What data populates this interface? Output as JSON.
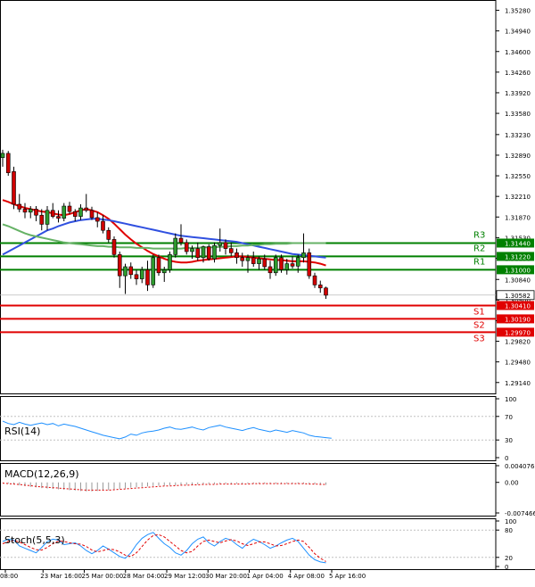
{
  "chart_data": {
    "type": "candlestick",
    "symbol": "GBPUSD",
    "price_axis": {
      "ylim": [
        1.2896,
        1.3545
      ],
      "ticks": [
        "1.35280",
        "1.34940",
        "1.34600",
        "1.34260",
        "1.33920",
        "1.33580",
        "1.33230",
        "1.32890",
        "1.32550",
        "1.32210",
        "1.31870",
        "1.31530",
        "1.31190",
        "1.30840",
        "1.30500",
        "1.30160",
        "1.29820",
        "1.29480",
        "1.29140"
      ]
    },
    "current_price": {
      "label": "1.30582",
      "value": 1.30582
    },
    "levels": [
      {
        "name": "R3",
        "label": "1.31440",
        "value": 1.3144,
        "color": "#008000"
      },
      {
        "name": "R2",
        "label": "1.31220",
        "value": 1.3122,
        "color": "#008000"
      },
      {
        "name": "R1",
        "label": "1.31000",
        "value": 1.31,
        "color": "#008000"
      },
      {
        "name": "S1",
        "label": "1.30410",
        "value": 1.3041,
        "color": "#e00000"
      },
      {
        "name": "S2",
        "label": "1.30190",
        "value": 1.3019,
        "color": "#e00000"
      },
      {
        "name": "S3",
        "label": "1.29970",
        "value": 1.2997,
        "color": "#e00000"
      }
    ],
    "time_labels": [
      "08:00",
      "23 Mar 16:00",
      "25 Mar 00:00",
      "28 Mar 04:00",
      "29 Mar 12:00",
      "30 Mar 20:00",
      "1 Apr 04:00",
      "4 Apr 08:00",
      "5 Apr 16:00"
    ],
    "candles": [
      {
        "o": 1.3285,
        "h": 1.3298,
        "l": 1.327,
        "c": 1.3292
      },
      {
        "o": 1.3292,
        "h": 1.3296,
        "l": 1.3255,
        "c": 1.326
      },
      {
        "o": 1.3262,
        "h": 1.327,
        "l": 1.32,
        "c": 1.3208
      },
      {
        "o": 1.3208,
        "h": 1.3225,
        "l": 1.3195,
        "c": 1.32
      },
      {
        "o": 1.32,
        "h": 1.321,
        "l": 1.3185,
        "c": 1.3195
      },
      {
        "o": 1.3195,
        "h": 1.3205,
        "l": 1.3185,
        "c": 1.32
      },
      {
        "o": 1.32,
        "h": 1.3205,
        "l": 1.318,
        "c": 1.319
      },
      {
        "o": 1.319,
        "h": 1.32,
        "l": 1.3165,
        "c": 1.3175
      },
      {
        "o": 1.3175,
        "h": 1.3205,
        "l": 1.3165,
        "c": 1.3198
      },
      {
        "o": 1.3198,
        "h": 1.321,
        "l": 1.3185,
        "c": 1.3188
      },
      {
        "o": 1.3188,
        "h": 1.3198,
        "l": 1.3178,
        "c": 1.3185
      },
      {
        "o": 1.3185,
        "h": 1.321,
        "l": 1.318,
        "c": 1.3205
      },
      {
        "o": 1.3205,
        "h": 1.3212,
        "l": 1.3192,
        "c": 1.3196
      },
      {
        "o": 1.3196,
        "h": 1.32,
        "l": 1.318,
        "c": 1.3188
      },
      {
        "o": 1.3188,
        "h": 1.3208,
        "l": 1.3182,
        "c": 1.3202
      },
      {
        "o": 1.3202,
        "h": 1.3225,
        "l": 1.3195,
        "c": 1.3198
      },
      {
        "o": 1.3198,
        "h": 1.3204,
        "l": 1.3182,
        "c": 1.3186
      },
      {
        "o": 1.3186,
        "h": 1.3195,
        "l": 1.317,
        "c": 1.318
      },
      {
        "o": 1.318,
        "h": 1.319,
        "l": 1.316,
        "c": 1.3165
      },
      {
        "o": 1.3165,
        "h": 1.317,
        "l": 1.3145,
        "c": 1.315
      },
      {
        "o": 1.315,
        "h": 1.3155,
        "l": 1.312,
        "c": 1.3125
      },
      {
        "o": 1.3125,
        "h": 1.313,
        "l": 1.307,
        "c": 1.309
      },
      {
        "o": 1.309,
        "h": 1.311,
        "l": 1.306,
        "c": 1.3105
      },
      {
        "o": 1.3105,
        "h": 1.3112,
        "l": 1.3085,
        "c": 1.3092
      },
      {
        "o": 1.3092,
        "h": 1.31,
        "l": 1.3075,
        "c": 1.3085
      },
      {
        "o": 1.3085,
        "h": 1.3105,
        "l": 1.3078,
        "c": 1.31
      },
      {
        "o": 1.31,
        "h": 1.3115,
        "l": 1.3065,
        "c": 1.3075
      },
      {
        "o": 1.3075,
        "h": 1.3125,
        "l": 1.307,
        "c": 1.312
      },
      {
        "o": 1.312,
        "h": 1.3125,
        "l": 1.309,
        "c": 1.3095
      },
      {
        "o": 1.3095,
        "h": 1.3105,
        "l": 1.308,
        "c": 1.31
      },
      {
        "o": 1.31,
        "h": 1.313,
        "l": 1.3095,
        "c": 1.3125
      },
      {
        "o": 1.3125,
        "h": 1.316,
        "l": 1.312,
        "c": 1.3152
      },
      {
        "o": 1.3152,
        "h": 1.3175,
        "l": 1.314,
        "c": 1.3145
      },
      {
        "o": 1.3145,
        "h": 1.315,
        "l": 1.3125,
        "c": 1.313
      },
      {
        "o": 1.313,
        "h": 1.314,
        "l": 1.3118,
        "c": 1.3135
      },
      {
        "o": 1.3135,
        "h": 1.3145,
        "l": 1.3115,
        "c": 1.312
      },
      {
        "o": 1.312,
        "h": 1.314,
        "l": 1.3112,
        "c": 1.3138
      },
      {
        "o": 1.3138,
        "h": 1.3142,
        "l": 1.3115,
        "c": 1.3118
      },
      {
        "o": 1.3118,
        "h": 1.3145,
        "l": 1.3112,
        "c": 1.314
      },
      {
        "o": 1.314,
        "h": 1.3168,
        "l": 1.313,
        "c": 1.3145
      },
      {
        "o": 1.3145,
        "h": 1.315,
        "l": 1.3125,
        "c": 1.3135
      },
      {
        "o": 1.3135,
        "h": 1.3145,
        "l": 1.3122,
        "c": 1.3128
      },
      {
        "o": 1.3128,
        "h": 1.3135,
        "l": 1.311,
        "c": 1.312
      },
      {
        "o": 1.312,
        "h": 1.3128,
        "l": 1.3105,
        "c": 1.3115
      },
      {
        "o": 1.3115,
        "h": 1.3125,
        "l": 1.3095,
        "c": 1.312
      },
      {
        "o": 1.312,
        "h": 1.313,
        "l": 1.3105,
        "c": 1.311
      },
      {
        "o": 1.311,
        "h": 1.3122,
        "l": 1.31,
        "c": 1.3118
      },
      {
        "o": 1.3118,
        "h": 1.3125,
        "l": 1.31,
        "c": 1.3105
      },
      {
        "o": 1.3105,
        "h": 1.3115,
        "l": 1.3085,
        "c": 1.3095
      },
      {
        "o": 1.3095,
        "h": 1.3125,
        "l": 1.309,
        "c": 1.312
      },
      {
        "o": 1.312,
        "h": 1.3125,
        "l": 1.3095,
        "c": 1.31
      },
      {
        "o": 1.31,
        "h": 1.3118,
        "l": 1.3092,
        "c": 1.311
      },
      {
        "o": 1.311,
        "h": 1.3122,
        "l": 1.3102,
        "c": 1.3106
      },
      {
        "o": 1.3106,
        "h": 1.3125,
        "l": 1.3095,
        "c": 1.312
      },
      {
        "o": 1.312,
        "h": 1.316,
        "l": 1.3112,
        "c": 1.3128
      },
      {
        "o": 1.3128,
        "h": 1.3135,
        "l": 1.3085,
        "c": 1.309
      },
      {
        "o": 1.309,
        "h": 1.3095,
        "l": 1.307,
        "c": 1.3075
      },
      {
        "o": 1.3075,
        "h": 1.3082,
        "l": 1.3062,
        "c": 1.307
      },
      {
        "o": 1.307,
        "h": 1.3072,
        "l": 1.3052,
        "c": 1.3058
      }
    ],
    "moving_averages": [
      {
        "color": "#e00000",
        "values": [
          1.3215,
          1.3212,
          1.3208,
          1.3205,
          1.3202,
          1.32,
          1.3198,
          1.3196,
          1.3195,
          1.3193,
          1.3191,
          1.319,
          1.3192,
          1.3195,
          1.3198,
          1.32,
          1.3198,
          1.3195,
          1.319,
          1.3184,
          1.3176,
          1.3167,
          1.3158,
          1.315,
          1.3143,
          1.3137,
          1.3131,
          1.3126,
          1.3122,
          1.3118,
          1.3115,
          1.3113,
          1.3112,
          1.3112,
          1.3113,
          1.3115,
          1.3116,
          1.3117,
          1.3118,
          1.3119,
          1.312,
          1.3121,
          1.3122,
          1.3122,
          1.3121,
          1.312,
          1.3119,
          1.3118,
          1.3117,
          1.3116,
          1.3116,
          1.3115,
          1.3114,
          1.3114,
          1.3114,
          1.3113,
          1.3112,
          1.311,
          1.3107
        ]
      },
      {
        "color": "#3050e0",
        "values": [
          1.3125,
          1.313,
          1.3135,
          1.314,
          1.3145,
          1.315,
          1.3155,
          1.316,
          1.3165,
          1.3168,
          1.3172,
          1.3175,
          1.3178,
          1.318,
          1.3182,
          1.3183,
          1.3184,
          1.3184,
          1.3183,
          1.3182,
          1.318,
          1.3178,
          1.3176,
          1.3174,
          1.3172,
          1.317,
          1.3168,
          1.3166,
          1.3164,
          1.3162,
          1.316,
          1.3158,
          1.3156,
          1.3155,
          1.3154,
          1.3153,
          1.3152,
          1.3151,
          1.315,
          1.3149,
          1.3148,
          1.3147,
          1.3146,
          1.3144,
          1.3142,
          1.314,
          1.3138,
          1.3136,
          1.3134,
          1.3132,
          1.313,
          1.3128,
          1.3126,
          1.3125,
          1.3124,
          1.3123,
          1.3122,
          1.3121,
          1.312
        ]
      },
      {
        "color": "#66b266",
        "values": [
          1.3175,
          1.3172,
          1.3168,
          1.3164,
          1.316,
          1.3157,
          1.3155,
          1.3153,
          1.3151,
          1.3149,
          1.3147,
          1.3145,
          1.3144,
          1.3143,
          1.3142,
          1.3141,
          1.314,
          1.3139,
          1.3139,
          1.3138,
          1.3138,
          1.3137,
          1.3137,
          1.3137,
          1.3136,
          1.3136,
          1.3136,
          1.3135,
          1.3135,
          1.3135,
          1.3135,
          1.3135,
          1.3135,
          1.3136,
          1.3136,
          1.3136,
          1.3137,
          1.3137,
          1.3137,
          1.3138,
          1.3138,
          1.3139,
          1.3139,
          1.314,
          1.314,
          1.3141,
          1.3141,
          1.3142,
          1.3142,
          1.3143,
          1.3143,
          1.3143,
          1.3144,
          1.3144,
          1.3144,
          1.3144,
          1.3144,
          1.3144,
          1.3144
        ]
      }
    ],
    "rsi": {
      "label": "RSI(14)",
      "ticks": [
        "100",
        "70",
        "30",
        "0"
      ],
      "ylim": [
        0,
        100
      ],
      "values": [
        62,
        58,
        56,
        60,
        57,
        55,
        57,
        59,
        56,
        58,
        54,
        57,
        55,
        53,
        50,
        47,
        44,
        41,
        38,
        36,
        34,
        32,
        35,
        40,
        38,
        42,
        44,
        45,
        47,
        50,
        52,
        49,
        48,
        50,
        52,
        49,
        47,
        51,
        53,
        55,
        52,
        50,
        48,
        46,
        49,
        51,
        48,
        46,
        44,
        47,
        45,
        43,
        46,
        44,
        42,
        38,
        36,
        35,
        34,
        33
      ]
    },
    "macd": {
      "label": "MACD(12,26,9)",
      "ticks": [
        "0.004076",
        "0.00",
        "-0.007466"
      ],
      "ylim": [
        -0.007466,
        0.004076
      ],
      "histogram": [
        -0.0001,
        -0.0003,
        -0.0005,
        -0.0007,
        -0.0009,
        -0.0011,
        -0.0012,
        -0.0014,
        -0.0015,
        -0.0016,
        -0.0017,
        -0.0018,
        -0.0019,
        -0.002,
        -0.0021,
        -0.0022,
        -0.0022,
        -0.0021,
        -0.002,
        -0.0019,
        -0.0018,
        -0.0016,
        -0.0015,
        -0.0013,
        -0.0012,
        -0.0011,
        -0.001,
        -0.0009,
        -0.0008,
        -0.0008,
        -0.0007,
        -0.0007,
        -0.0006,
        -0.0006,
        -0.0005,
        -0.0005,
        -0.0004,
        -0.0004,
        -0.0004,
        -0.0003,
        -0.0003,
        -0.0003,
        -0.0003,
        -0.0003,
        -0.0003,
        -0.0003,
        -0.0003,
        -0.0003,
        -0.0003,
        -0.0003,
        -0.0003,
        -0.0003,
        -0.0003,
        -0.0003,
        -0.0003,
        -0.0003,
        -0.0004,
        -0.0005,
        -0.0006
      ],
      "signal": [
        -0.0002,
        -0.0003,
        -0.0004,
        -0.0005,
        -0.0007,
        -0.0008,
        -0.001,
        -0.0011,
        -0.0012,
        -0.0013,
        -0.0014,
        -0.0015,
        -0.0016,
        -0.0017,
        -0.0018,
        -0.0019,
        -0.0019,
        -0.0019,
        -0.0019,
        -0.0019,
        -0.0018,
        -0.0017,
        -0.0016,
        -0.0015,
        -0.0014,
        -0.0013,
        -0.0012,
        -0.0011,
        -0.001,
        -0.0009,
        -0.0009,
        -0.0008,
        -0.0007,
        -0.0007,
        -0.0006,
        -0.0006,
        -0.0005,
        -0.0005,
        -0.0005,
        -0.0004,
        -0.0004,
        -0.0004,
        -0.0004,
        -0.0004,
        -0.0004,
        -0.0003,
        -0.0003,
        -0.0003,
        -0.0003,
        -0.0003,
        -0.0003,
        -0.0003,
        -0.0003,
        -0.0003,
        -0.0003,
        -0.0004,
        -0.0004,
        -0.0005,
        -0.0005
      ]
    },
    "stoch": {
      "label": "Stoch(5,5,3)",
      "ticks": [
        "100",
        "80",
        "20",
        "0"
      ],
      "ylim": [
        0,
        100
      ],
      "main": [
        55,
        60,
        58,
        45,
        40,
        35,
        30,
        42,
        55,
        60,
        58,
        48,
        50,
        52,
        45,
        35,
        28,
        35,
        45,
        38,
        30,
        22,
        18,
        30,
        48,
        62,
        70,
        75,
        62,
        50,
        42,
        30,
        25,
        35,
        50,
        60,
        65,
        52,
        45,
        55,
        62,
        58,
        48,
        40,
        52,
        60,
        55,
        48,
        40,
        45,
        52,
        58,
        62,
        55,
        40,
        25,
        15,
        10,
        8
      ],
      "signal": [
        50,
        55,
        57,
        54,
        48,
        42,
        37,
        36,
        42,
        50,
        56,
        55,
        52,
        50,
        49,
        44,
        36,
        32,
        35,
        38,
        37,
        32,
        25,
        22,
        30,
        44,
        58,
        68,
        70,
        65,
        55,
        45,
        35,
        30,
        33,
        45,
        55,
        58,
        55,
        52,
        56,
        59,
        56,
        50,
        46,
        50,
        54,
        54,
        50,
        45,
        46,
        50,
        55,
        58,
        55,
        42,
        28,
        18,
        11
      ]
    }
  }
}
